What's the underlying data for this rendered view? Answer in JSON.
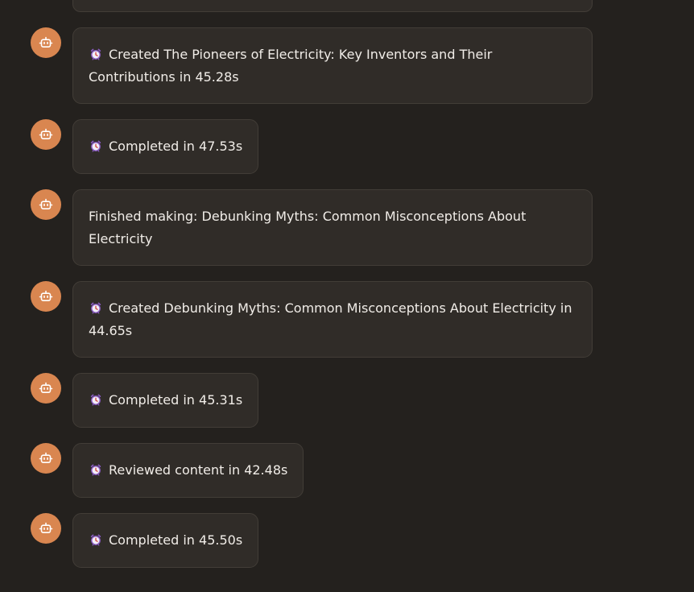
{
  "messages": [
    {
      "text": "Created The Pioneers of Electricity: Key Inventors and Their Contributions in 45.28s",
      "icon": "alarm-clock-icon",
      "avatar_icon": "robot-icon"
    },
    {
      "text": "Completed in 47.53s",
      "icon": "alarm-clock-icon",
      "avatar_icon": "robot-icon"
    },
    {
      "text": "Finished making: Debunking Myths: Common Misconceptions About Electricity",
      "icon": null,
      "avatar_icon": "robot-icon"
    },
    {
      "text": "Created Debunking Myths: Common Misconceptions About Electricity in 44.65s",
      "icon": "alarm-clock-icon",
      "avatar_icon": "robot-icon"
    },
    {
      "text": "Completed in 45.31s",
      "icon": "alarm-clock-icon",
      "avatar_icon": "robot-icon"
    },
    {
      "text": "Reviewed content in 42.48s",
      "icon": "alarm-clock-icon",
      "avatar_icon": "robot-icon"
    },
    {
      "text": "Completed in 45.50s",
      "icon": "alarm-clock-icon",
      "avatar_icon": "robot-icon"
    }
  ],
  "colors": {
    "background": "#24211e",
    "bubble": "#302c28",
    "bubble_border": "#423d37",
    "avatar": "#d98650",
    "text": "#f1ede8"
  }
}
